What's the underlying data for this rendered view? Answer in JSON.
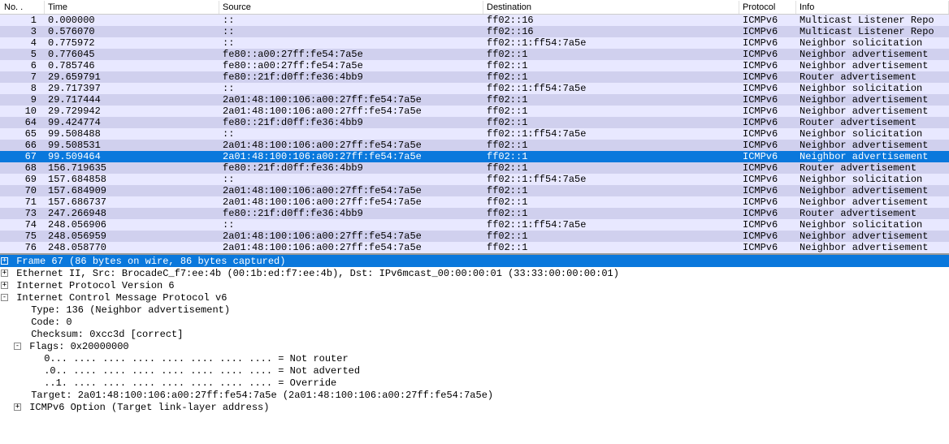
{
  "columns": {
    "no": "No. .",
    "time": "Time",
    "source": "Source",
    "destination": "Destination",
    "protocol": "Protocol",
    "info": "Info"
  },
  "packets": [
    {
      "no": "1",
      "time": "0.000000",
      "source": "::",
      "destination": "ff02::16",
      "protocol": "ICMPv6",
      "info": "Multicast Listener Repo",
      "alt": 0,
      "sel": false
    },
    {
      "no": "3",
      "time": "0.576070",
      "source": "::",
      "destination": "ff02::16",
      "protocol": "ICMPv6",
      "info": "Multicast Listener Repo",
      "alt": 1,
      "sel": false
    },
    {
      "no": "4",
      "time": "0.775972",
      "source": "::",
      "destination": "ff02::1:ff54:7a5e",
      "protocol": "ICMPv6",
      "info": "Neighbor solicitation",
      "alt": 0,
      "sel": false
    },
    {
      "no": "5",
      "time": "0.776045",
      "source": "fe80::a00:27ff:fe54:7a5e",
      "destination": "ff02::1",
      "protocol": "ICMPv6",
      "info": "Neighbor advertisement",
      "alt": 1,
      "sel": false
    },
    {
      "no": "6",
      "time": "0.785746",
      "source": "fe80::a00:27ff:fe54:7a5e",
      "destination": "ff02::1",
      "protocol": "ICMPv6",
      "info": "Neighbor advertisement",
      "alt": 0,
      "sel": false
    },
    {
      "no": "7",
      "time": "29.659791",
      "source": "fe80::21f:d0ff:fe36:4bb9",
      "destination": "ff02::1",
      "protocol": "ICMPv6",
      "info": "Router advertisement",
      "alt": 1,
      "sel": false
    },
    {
      "no": "8",
      "time": "29.717397",
      "source": "::",
      "destination": "ff02::1:ff54:7a5e",
      "protocol": "ICMPv6",
      "info": "Neighbor solicitation",
      "alt": 0,
      "sel": false
    },
    {
      "no": "9",
      "time": "29.717444",
      "source": "2a01:48:100:106:a00:27ff:fe54:7a5e",
      "destination": "ff02::1",
      "protocol": "ICMPv6",
      "info": "Neighbor advertisement",
      "alt": 1,
      "sel": false
    },
    {
      "no": "10",
      "time": "29.729942",
      "source": "2a01:48:100:106:a00:27ff:fe54:7a5e",
      "destination": "ff02::1",
      "protocol": "ICMPv6",
      "info": "Neighbor advertisement",
      "alt": 0,
      "sel": false
    },
    {
      "no": "64",
      "time": "99.424774",
      "source": "fe80::21f:d0ff:fe36:4bb9",
      "destination": "ff02::1",
      "protocol": "ICMPv6",
      "info": "Router advertisement",
      "alt": 1,
      "sel": false
    },
    {
      "no": "65",
      "time": "99.508488",
      "source": "::",
      "destination": "ff02::1:ff54:7a5e",
      "protocol": "ICMPv6",
      "info": "Neighbor solicitation",
      "alt": 0,
      "sel": false
    },
    {
      "no": "66",
      "time": "99.508531",
      "source": "2a01:48:100:106:a00:27ff:fe54:7a5e",
      "destination": "ff02::1",
      "protocol": "ICMPv6",
      "info": "Neighbor advertisement",
      "alt": 1,
      "sel": false
    },
    {
      "no": "67",
      "time": "99.509464",
      "source": "2a01:48:100:106:a00:27ff:fe54:7a5e",
      "destination": "ff02::1",
      "protocol": "ICMPv6",
      "info": "Neighbor advertisement",
      "alt": 0,
      "sel": true
    },
    {
      "no": "68",
      "time": "156.719635",
      "source": "fe80::21f:d0ff:fe36:4bb9",
      "destination": "ff02::1",
      "protocol": "ICMPv6",
      "info": "Router advertisement",
      "alt": 1,
      "sel": false
    },
    {
      "no": "69",
      "time": "157.684858",
      "source": "::",
      "destination": "ff02::1:ff54:7a5e",
      "protocol": "ICMPv6",
      "info": "Neighbor solicitation",
      "alt": 0,
      "sel": false
    },
    {
      "no": "70",
      "time": "157.684909",
      "source": "2a01:48:100:106:a00:27ff:fe54:7a5e",
      "destination": "ff02::1",
      "protocol": "ICMPv6",
      "info": "Neighbor advertisement",
      "alt": 1,
      "sel": false
    },
    {
      "no": "71",
      "time": "157.686737",
      "source": "2a01:48:100:106:a00:27ff:fe54:7a5e",
      "destination": "ff02::1",
      "protocol": "ICMPv6",
      "info": "Neighbor advertisement",
      "alt": 0,
      "sel": false
    },
    {
      "no": "73",
      "time": "247.266948",
      "source": "fe80::21f:d0ff:fe36:4bb9",
      "destination": "ff02::1",
      "protocol": "ICMPv6",
      "info": "Router advertisement",
      "alt": 1,
      "sel": false
    },
    {
      "no": "74",
      "time": "248.056906",
      "source": "::",
      "destination": "ff02::1:ff54:7a5e",
      "protocol": "ICMPv6",
      "info": "Neighbor solicitation",
      "alt": 0,
      "sel": false
    },
    {
      "no": "75",
      "time": "248.056959",
      "source": "2a01:48:100:106:a00:27ff:fe54:7a5e",
      "destination": "ff02::1",
      "protocol": "ICMPv6",
      "info": "Neighbor advertisement",
      "alt": 1,
      "sel": false
    },
    {
      "no": "76",
      "time": "248.058770",
      "source": "2a01:48:100:106:a00:27ff:fe54:7a5e",
      "destination": "ff02::1",
      "protocol": "ICMPv6",
      "info": "Neighbor advertisement",
      "alt": 0,
      "sel": false
    }
  ],
  "details": [
    {
      "indent": 0,
      "expander": "+",
      "text": "Frame 67 (86 bytes on wire, 86 bytes captured)",
      "selected": true
    },
    {
      "indent": 0,
      "expander": "+",
      "text": "Ethernet II, Src: BrocadeC_f7:ee:4b (00:1b:ed:f7:ee:4b), Dst: IPv6mcast_00:00:00:01 (33:33:00:00:00:01)",
      "selected": false
    },
    {
      "indent": 0,
      "expander": "+",
      "text": "Internet Protocol Version 6",
      "selected": false
    },
    {
      "indent": 0,
      "expander": "-",
      "text": "Internet Control Message Protocol v6",
      "selected": false
    },
    {
      "indent": 1,
      "expander": "",
      "text": "Type: 136 (Neighbor advertisement)",
      "selected": false
    },
    {
      "indent": 1,
      "expander": "",
      "text": "Code: 0",
      "selected": false
    },
    {
      "indent": 1,
      "expander": "",
      "text": "Checksum: 0xcc3d [correct]",
      "selected": false
    },
    {
      "indent": 1,
      "expander": "-",
      "text": "Flags: 0x20000000",
      "selected": false
    },
    {
      "indent": 2,
      "expander": "",
      "text": "0... .... .... .... .... .... .... .... = Not router",
      "selected": false
    },
    {
      "indent": 2,
      "expander": "",
      "text": ".0.. .... .... .... .... .... .... .... = Not adverted",
      "selected": false
    },
    {
      "indent": 2,
      "expander": "",
      "text": "..1. .... .... .... .... .... .... .... = Override",
      "selected": false
    },
    {
      "indent": 1,
      "expander": "",
      "text": "Target: 2a01:48:100:106:a00:27ff:fe54:7a5e (2a01:48:100:106:a00:27ff:fe54:7a5e)",
      "selected": false
    },
    {
      "indent": 1,
      "expander": "+",
      "text": "ICMPv6 Option (Target link-layer address)",
      "selected": false
    }
  ]
}
